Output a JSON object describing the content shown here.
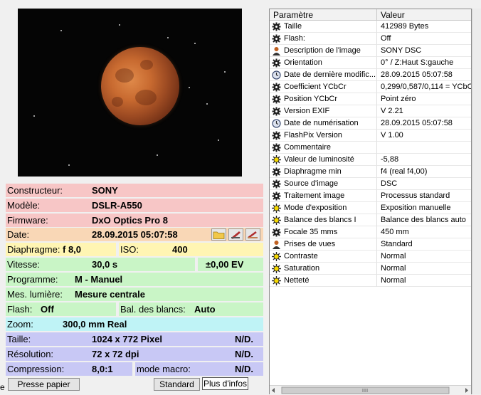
{
  "info": {
    "constructeur": {
      "label": "Constructeur:",
      "value": "SONY"
    },
    "modele": {
      "label": "Modèle:",
      "value": "DSLR-A550"
    },
    "firmware": {
      "label": "Firmware:",
      "value": "DxO Optics Pro 8"
    },
    "date": {
      "label": "Date:",
      "value": "28.09.2015 05:07:58"
    },
    "diaphragme": {
      "label": "Diaphragme:",
      "value": "f 8,0"
    },
    "iso": {
      "label": "ISO:",
      "value": "400"
    },
    "vitesse": {
      "label": "Vitesse:",
      "value": "30,0 s",
      "ev": "±0,00 EV"
    },
    "programme": {
      "label": "Programme:",
      "value": "M - Manuel"
    },
    "mesure": {
      "label": "Mes. lumière:",
      "value": "Mesure centrale"
    },
    "flash": {
      "label": "Flash:",
      "value": "Off"
    },
    "balance": {
      "label": "Bal. des blancs:",
      "value": "Auto"
    },
    "zoom": {
      "label": "Zoom:",
      "value": "300,0 mm Real"
    },
    "taille": {
      "label": "Taille:",
      "value": "1024 x 772 Pixel",
      "extra": "N/D."
    },
    "resolution": {
      "label": "Résolution:",
      "value": "72 x 72 dpi",
      "extra": "N/D."
    },
    "compression": {
      "label": "Compression:",
      "value": "8,0:1",
      "macro_label": "mode macro:",
      "extra": "N/D."
    }
  },
  "buttons": {
    "presse": "Presse papier",
    "standard": "Standard",
    "plus": "Plus d'infos",
    "edge_char": "e"
  },
  "table": {
    "headers": [
      "Paramètre",
      "Valeur"
    ],
    "rows": [
      {
        "icon": "gear-icon",
        "name": "Taille",
        "value": "412989 Bytes"
      },
      {
        "icon": "gear-icon",
        "name": "Flash:",
        "value": "Off"
      },
      {
        "icon": "person-icon",
        "name": "Description de l'image",
        "value": "SONY DSC"
      },
      {
        "icon": "gear-icon",
        "name": "Orientation",
        "value": "0° / Z:Haut S:gauche"
      },
      {
        "icon": "clock-icon",
        "name": "Date de dernière modific...",
        "value": "28.09.2015 05:07:58"
      },
      {
        "icon": "gear-icon",
        "name": "Coefficient YCbCr",
        "value": "0,299/0,587/0,114 = YCbC"
      },
      {
        "icon": "gear-icon",
        "name": "Position YCbCr",
        "value": "Point zéro"
      },
      {
        "icon": "gear-icon",
        "name": "Version EXIF",
        "value": "V 2.21"
      },
      {
        "icon": "clock-icon",
        "name": "Date de numérisation",
        "value": "28.09.2015 05:07:58"
      },
      {
        "icon": "gear-icon",
        "name": "FlashPix Version",
        "value": "V 1.00"
      },
      {
        "icon": "gear-icon",
        "name": "Commentaire",
        "value": ""
      },
      {
        "icon": "sun-icon",
        "name": "Valeur de luminosité",
        "value": "-5,88"
      },
      {
        "icon": "gear-icon",
        "name": "Diaphragme min",
        "value": "f4 (real f4,00)"
      },
      {
        "icon": "gear-icon",
        "name": "Source d'image",
        "value": "DSC"
      },
      {
        "icon": "gear-icon",
        "name": "Traitement image",
        "value": "Processus standard"
      },
      {
        "icon": "sun-icon",
        "name": "Mode d'exposition",
        "value": "Exposition manuelle"
      },
      {
        "icon": "sun-icon",
        "name": "Balance des blancs I",
        "value": "Balance des blancs auto"
      },
      {
        "icon": "gear-icon",
        "name": "Focale 35 mms",
        "value": "450 mm"
      },
      {
        "icon": "person-icon",
        "name": "Prises de vues",
        "value": "Standard"
      },
      {
        "icon": "sun-icon",
        "name": "Contraste",
        "value": "Normal"
      },
      {
        "icon": "sun-icon",
        "name": "Saturation",
        "value": "Normal"
      },
      {
        "icon": "sun-icon",
        "name": "Netteté",
        "value": "Normal"
      }
    ]
  },
  "colors": {
    "pink": "#f7c6c6",
    "peach": "#f9d7b6",
    "yellow": "#fff5b3",
    "green": "#c9f5c6",
    "cyan": "#bff3f6",
    "violet": "#c8c8f5"
  }
}
